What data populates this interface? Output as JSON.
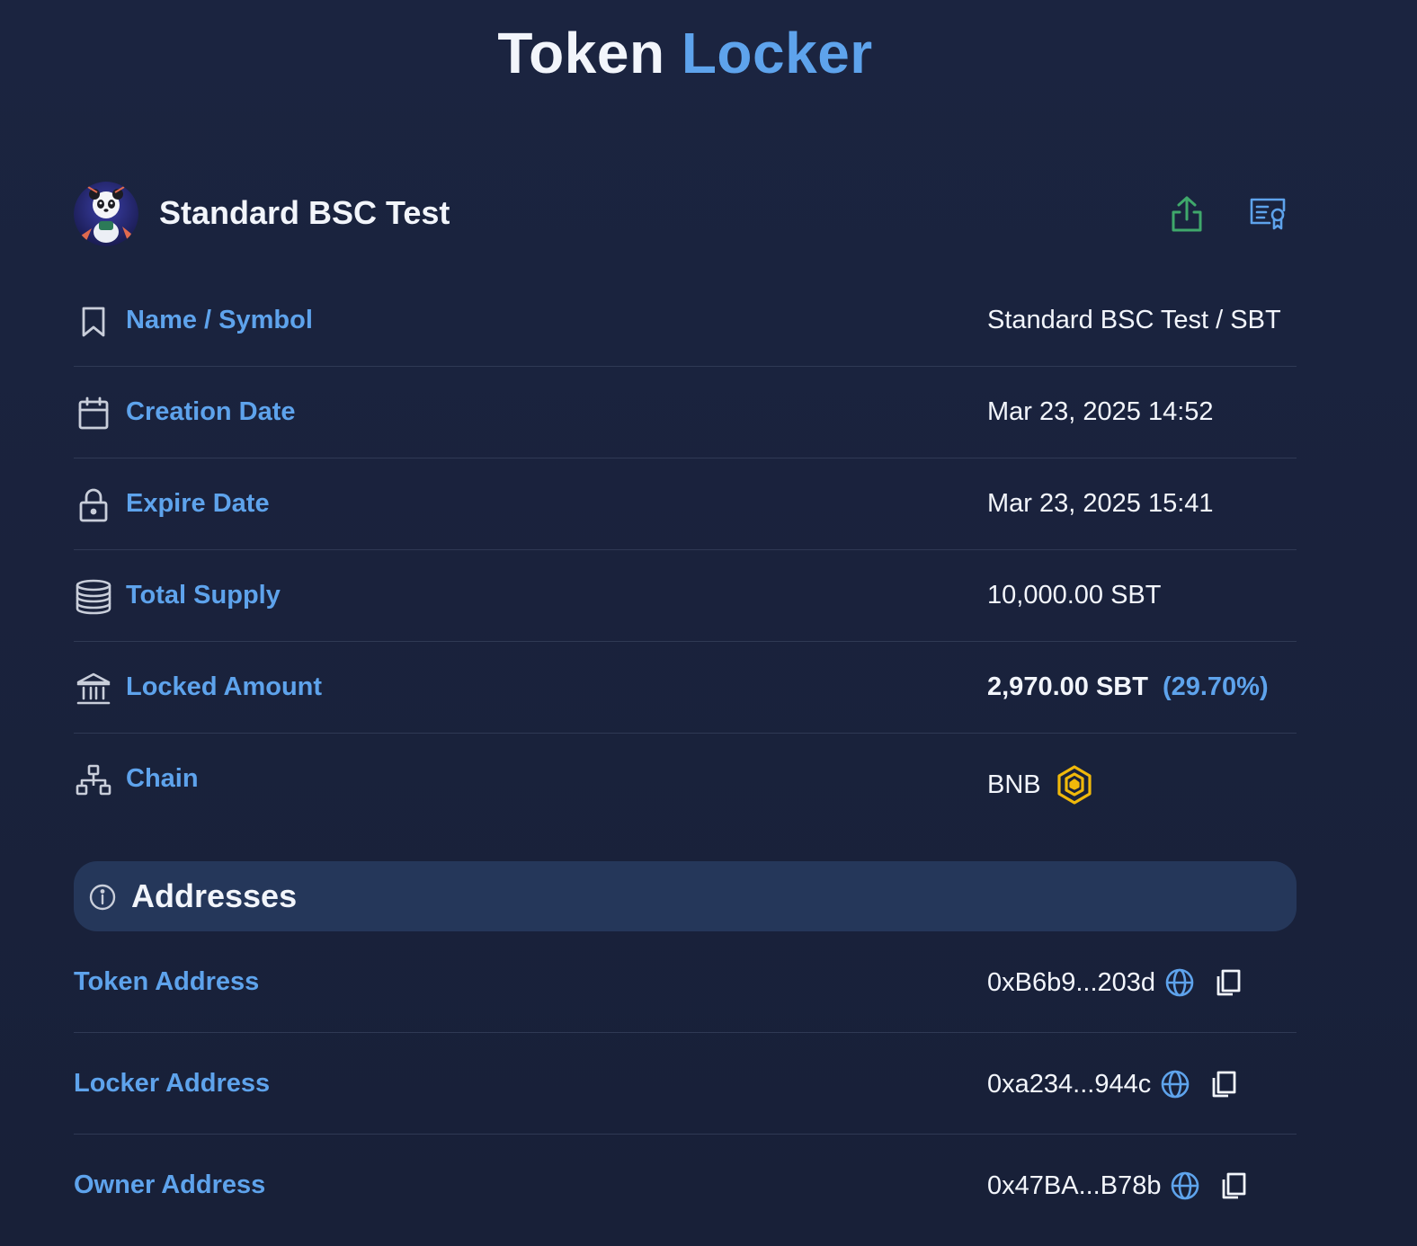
{
  "title": {
    "main": "Token",
    "accent": "Locker"
  },
  "colors": {
    "accent": "#5ea3ec",
    "share_green": "#3fa86b",
    "bnb_yellow": "#f0b90b",
    "address_bar": "#25375a"
  },
  "token": {
    "name": "Standard BSC Test",
    "avatar_icon": "panda-avatar-icon",
    "actions": [
      {
        "icon": "share-icon"
      },
      {
        "icon": "certificate-icon"
      }
    ]
  },
  "details": {
    "name_symbol": {
      "label": "Name / Symbol",
      "value": "Standard BSC Test / SBT",
      "icon": "bookmark-icon"
    },
    "creation_date": {
      "label": "Creation Date",
      "value": "Mar 23, 2025 14:52",
      "icon": "calendar-icon"
    },
    "expire_date": {
      "label": "Expire Date",
      "value": "Mar 23, 2025 15:41",
      "icon": "lock-icon"
    },
    "total_supply": {
      "label": "Total Supply",
      "value": "10,000.00 SBT",
      "icon": "coins-icon"
    },
    "locked_amount": {
      "label": "Locked Amount",
      "value": "2,970.00 SBT",
      "percent": "(29.70%)",
      "icon": "bank-icon"
    },
    "chain": {
      "label": "Chain",
      "value": "BNB",
      "icon": "network-icon",
      "chain_icon": "bnb-icon"
    }
  },
  "addresses": {
    "title": "Addresses",
    "icon": "info-icon",
    "token": {
      "label": "Token Address",
      "value": "0xB6b9...203d"
    },
    "locker": {
      "label": "Locker Address",
      "value": "0xa234...944c"
    },
    "owner": {
      "label": "Owner Address",
      "value": "0x47BA...B78b"
    }
  }
}
